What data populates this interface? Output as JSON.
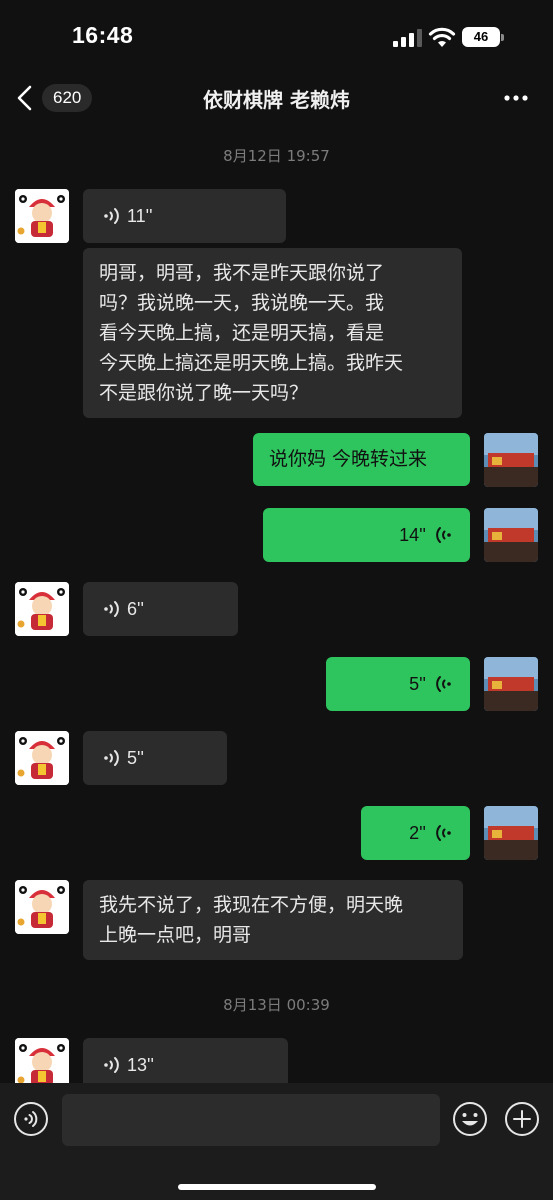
{
  "status_bar": {
    "time": "16:48",
    "battery": "46"
  },
  "header": {
    "unread_count": "620",
    "title": "依财棋牌 老赖炜"
  },
  "timestamps": [
    "8月12日 19:57",
    "8月13日 00:39"
  ],
  "messages": [
    {
      "type": "voice",
      "side": "in",
      "duration": "11''"
    },
    {
      "type": "text",
      "side": "in",
      "lines": [
        "明哥，明哥，我不是昨天跟你说了",
        "吗？我说晚一天，我说晚一天。我",
        "看今天晚上搞，还是明天搞，看是",
        "今天晚上搞还是明天晚上搞。我昨天",
        "不是跟你说了晚一天吗？"
      ]
    },
    {
      "type": "text",
      "side": "out",
      "text": "说你妈  今晚转过来"
    },
    {
      "type": "voice",
      "side": "out",
      "duration": "14''"
    },
    {
      "type": "voice",
      "side": "in",
      "duration": "6''"
    },
    {
      "type": "voice",
      "side": "out",
      "duration": "5''"
    },
    {
      "type": "voice",
      "side": "in",
      "duration": "5''"
    },
    {
      "type": "voice",
      "side": "out",
      "duration": "2''"
    },
    {
      "type": "text",
      "side": "in",
      "lines": [
        "我先不说了，我现在不方便，明天晚",
        "上晚一点吧，明哥"
      ]
    },
    {
      "type": "voice",
      "side": "in",
      "duration": "13''"
    }
  ],
  "input": {
    "placeholder": ""
  },
  "colors": {
    "background": "#111111",
    "incoming_bubble": "#2c2c2c",
    "outgoing_bubble": "#2fc55e"
  }
}
